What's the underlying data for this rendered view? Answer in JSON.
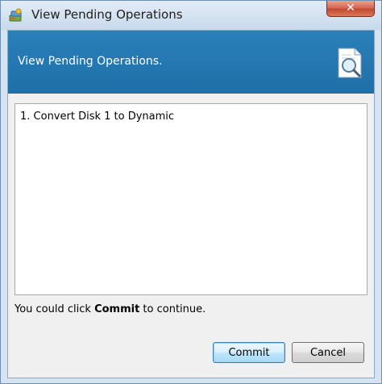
{
  "window": {
    "title": "View Pending Operations",
    "close_label": "✕"
  },
  "header": {
    "title": "View Pending Operations."
  },
  "operations": {
    "items": [
      "1. Convert Disk 1 to Dynamic"
    ]
  },
  "hint": {
    "prefix": "You could click ",
    "emphasis": "Commit",
    "suffix": " to continue."
  },
  "buttons": {
    "commit_label": "Commit",
    "cancel_label": "Cancel"
  },
  "colors": {
    "header_band": "#2072ab",
    "title_bar": "#d6e3f1",
    "close_button": "#c9523b"
  },
  "icons": {
    "app": "disk-manager-icon",
    "header": "magnifier-document-icon",
    "close": "close-icon"
  }
}
